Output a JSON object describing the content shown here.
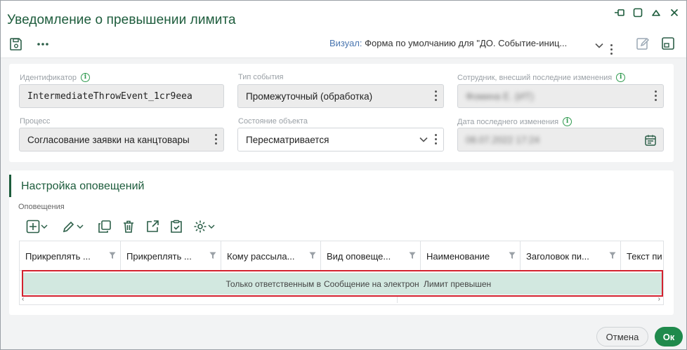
{
  "dialog": {
    "title": "Уведомление о превышении лимита"
  },
  "toolbar": {
    "visual_label": "Визуал:",
    "visual_value": "Форма по умолчанию для \"ДО. Событие-иниц..."
  },
  "fields": {
    "identifier": {
      "label": "Идентификатор",
      "value": "IntermediateThrowEvent_1cr9eea"
    },
    "event_type": {
      "label": "Тип события",
      "value": "Промежуточный (обработка)"
    },
    "last_employee": {
      "label": "Сотрудник, внесший последние изменения",
      "value": "Фомина Е. (ИТ)"
    },
    "process": {
      "label": "Процесс",
      "value": "Согласование заявки на канцтовары"
    },
    "object_state": {
      "label": "Состояние объекта",
      "value": "Пересматривается"
    },
    "last_change_date": {
      "label": "Дата последнего изменения",
      "value": "08.07.2022 17:24"
    }
  },
  "notifications": {
    "section_title": "Настройка оповещений",
    "sub_label": "Оповещения",
    "columns": [
      "Прикреплять ...",
      "Прикреплять ...",
      "Кому рассыла...",
      "Вид оповеще...",
      "Наименование",
      "Заголовок пи...",
      "Текст пи"
    ],
    "rows": [
      [
        "",
        "",
        "Только ответственным в",
        "Сообщение на электрон",
        "Лимит превышен",
        "",
        ""
      ]
    ]
  },
  "footer": {
    "cancel_label": "Отмена",
    "ok_label": "Ок"
  },
  "colors": {
    "accent": "#1d5c3c",
    "ok_button": "#1f8a4c",
    "selected_row": "#d2e8e0",
    "highlight_border": "#d3222f"
  }
}
